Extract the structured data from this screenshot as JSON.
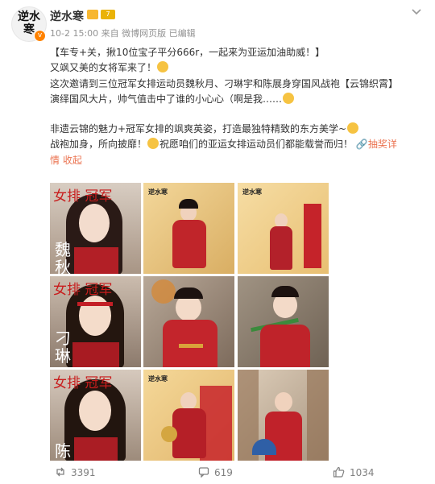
{
  "post": {
    "avatar_text": "逆水寒",
    "user_name": "逆水寒",
    "level_badge": "7",
    "meta": "10-2 15:00 来自 微博网页版 已编辑",
    "lines": [
      "【车专+关，揪10位宝子平分666r，一起来为亚运加油助威！】",
      "又飒又美的女将军来了！",
      "这次邀请到三位冠军女排运动员魏秋月、刁琳宇和陈展身穿国风战袍【云锦织霄】",
      "演绎国风大片，帅气值击中了谁的小心心（啊是我……",
      "非遗云锦的魅力+冠军女排的飒爽英姿，打造最独特精致的东方美学~",
      "战袍加身，所向披靡！",
      "祝愿咱们的亚运女排运动员们都能载誉而归！",
      "抽奖详",
      "情",
      "收起"
    ]
  },
  "photos": [
    {
      "tag": "女排 冠军",
      "vname": "魏秋",
      "bg": "#b8a99b",
      "logo": ""
    },
    {
      "tag": "",
      "vname": "",
      "bg": "#e8c784",
      "logo": "逆水寒"
    },
    {
      "tag": "",
      "vname": "",
      "bg": "#f1d293",
      "logo": "逆水寒"
    },
    {
      "tag": "女排 冠军",
      "vname": "刁琳",
      "bg": "#9c8c80",
      "logo": ""
    },
    {
      "tag": "",
      "vname": "",
      "bg": "#a89a8a",
      "logo": ""
    },
    {
      "tag": "",
      "vname": "",
      "bg": "#8f8276",
      "logo": ""
    },
    {
      "tag": "女排 冠军",
      "vname": "陈",
      "bg": "#b5a79a",
      "logo": ""
    },
    {
      "tag": "",
      "vname": "",
      "bg": "#efcf8d",
      "logo": "逆水寒"
    },
    {
      "tag": "",
      "vname": "",
      "bg": "#cdbba7",
      "logo": ""
    }
  ],
  "actions": {
    "repost": "3391",
    "comment": "619",
    "like": "1034"
  }
}
